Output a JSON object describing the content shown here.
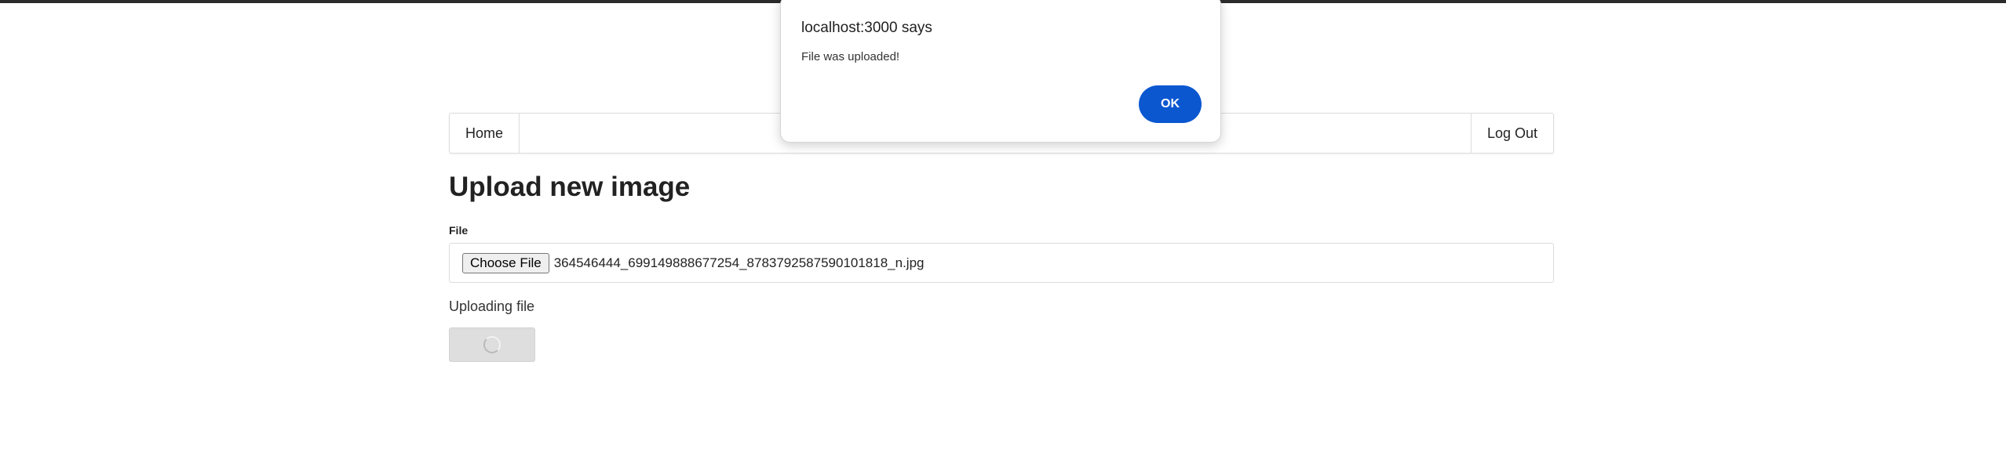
{
  "nav": {
    "home_label": "Home",
    "logout_label": "Log Out"
  },
  "page": {
    "title": "Upload new image",
    "file_label": "File",
    "choose_file_label": "Choose File",
    "selected_file": "364546444_699149888677254_8783792587590101818_n.jpg",
    "status": "Uploading file"
  },
  "dialog": {
    "title": "localhost:3000 says",
    "message": "File was uploaded!",
    "ok_label": "OK"
  },
  "icons": {
    "upload_button_icon": "loading-spinner-icon"
  },
  "colors": {
    "dialog_ok": "#0b57d0",
    "upload_button_disabled": "#dedede"
  }
}
